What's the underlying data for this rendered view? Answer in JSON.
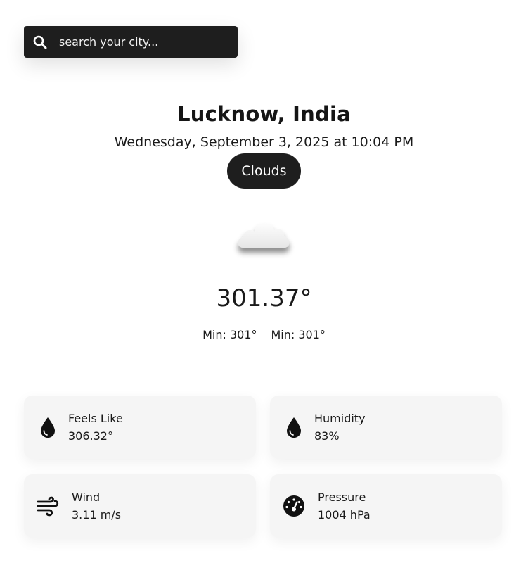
{
  "search": {
    "placeholder": "search your city...",
    "icon": "search-icon"
  },
  "location": {
    "title": "Lucknow, India",
    "datetime": "Wednesday, September 3, 2025 at 10:04 PM"
  },
  "condition": {
    "label": "Clouds",
    "icon": "cloud-icon"
  },
  "temperature": {
    "current": "301.37°",
    "min_label": "Min: 301°",
    "max_label": "Min: 301°"
  },
  "cards": {
    "feels_like": {
      "label": "Feels Like",
      "value": "306.32°",
      "icon": "droplet-icon"
    },
    "humidity": {
      "label": "Humidity",
      "value": "83%",
      "icon": "droplet-icon"
    },
    "wind": {
      "label": "Wind",
      "value": "3.11 m/s",
      "icon": "wind-icon"
    },
    "pressure": {
      "label": "Pressure",
      "value": "1004 hPa",
      "icon": "gauge-icon"
    }
  },
  "colors": {
    "dark": "#1e1e1e",
    "card_bg": "#f5f5f5",
    "page_bg": "#ffffff"
  }
}
